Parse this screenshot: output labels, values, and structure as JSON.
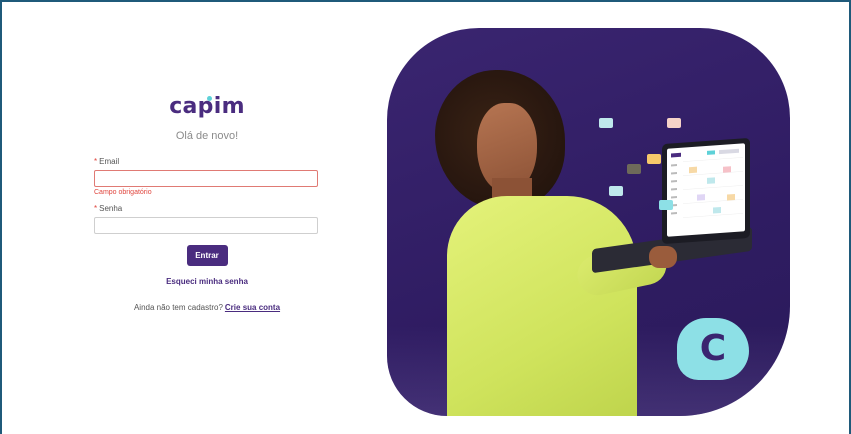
{
  "brand": {
    "name": "capim",
    "logo_icon": "capim-c-logo"
  },
  "login": {
    "greeting": "Olá de novo!",
    "email": {
      "required_mark": "*",
      "label": "Email",
      "value": "",
      "error": "Campo obrigatório"
    },
    "password": {
      "required_mark": "*",
      "label": "Senha",
      "value": ""
    },
    "submit_label": "Entrar",
    "forgot_label": "Esqueci minha senha",
    "signup_prompt": "Ainda não tem cadastro?",
    "signup_link": "Crie sua conta"
  },
  "hero": {
    "logo_letter": "C"
  },
  "colors": {
    "brand_purple": "#4a2c7f",
    "accent_cyan": "#8de0e6",
    "error_red": "#e0463e",
    "hero_bg": "#3a2570",
    "shirt_yellow": "#d8ea66"
  }
}
